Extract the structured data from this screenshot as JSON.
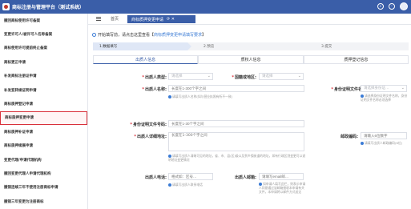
{
  "app": {
    "title": "商标注册与管理平台（测试系统）",
    "colors": {
      "header": "#3a5ea8",
      "accent": "#d9303a",
      "link": "#3a7bd5"
    }
  },
  "topbar_icons": [
    "search-icon",
    "notification-icon",
    "user-avatar"
  ],
  "sidebar": {
    "items": [
      {
        "label": "撤回商标使用许可备案"
      },
      {
        "label": "变更许可人/被许可人名称备案"
      },
      {
        "label": "商标使用许可提前终止备案"
      },
      {
        "label": "商标更正申请"
      },
      {
        "label": "补发商标注册证申请"
      },
      {
        "label": "补发变转续证明申请"
      },
      {
        "label": "商标质押登记申请"
      },
      {
        "label": "商标质押变更申请",
        "active": true
      },
      {
        "label": "商标质押补证申请"
      },
      {
        "label": "商标质押续展申请"
      },
      {
        "label": "变更代理/申请代理机构"
      },
      {
        "label": "撤回变更代理人申请代理机构"
      },
      {
        "label": "撤销连续三年不使用注册商标申请"
      },
      {
        "label": "撤销三年变更为注册商标"
      }
    ]
  },
  "tabs": {
    "home": "首页",
    "active": "商标质押变更申请",
    "active_actions": "⟳ ✕"
  },
  "notice": {
    "prefix": "开始填写前，请点击这里查看【",
    "link": "商标质押变更申请填写要求",
    "suffix": "】"
  },
  "steps": [
    "1.数据填写",
    "2.预览",
    "3.提交"
  ],
  "subtabs": [
    "出质人信息",
    "质权人信息",
    "质押登记信息"
  ],
  "form": {
    "pledgor_type": {
      "label": "出质人类型:",
      "placeholder": "请选择"
    },
    "country": {
      "label": "国籍或地区:",
      "placeholder": "请选择"
    },
    "pledgor_name": {
      "label": "出质人名称:",
      "placeholder": "长度在1-300个字之间",
      "hint": "请填写出质人名称(如与营业执照有所不一致)"
    },
    "id_doc_name": {
      "label": "身份证明文件名称:",
      "placeholder": "请选择身份证…",
      "hint": "请选择身份证明文件名称，身份证明文件名称必须选择"
    },
    "id_doc_number": {
      "label": "身份证明文件号码:",
      "placeholder": "长度在1-30个字之间"
    },
    "address": {
      "label": "出质人详细地址:",
      "placeholder": "长度在1-300个字之间",
      "hint": "请填写出质人清晰可见的地址，省、市、县(区)级以及到乡镇街道的地址，如有行政区划变更可以说明地址变更情况"
    },
    "postcode": {
      "label": "邮政编码:",
      "placeholder": "请输入6位数字",
      "hint": "请填写出质人邮政编码(6位)"
    },
    "phone": {
      "label": "出质人电话:",
      "placeholder": "格式如：区号…",
      "hint": "请填写出质人联系电话"
    },
    "email": {
      "label": "出质人邮箱:",
      "placeholder": "请填写email邮…",
      "hint": "如申请人填写此栏，则表示申请人同意通过该邮箱接收本申请有关文件，本申请将以邮件方式送达"
    }
  }
}
